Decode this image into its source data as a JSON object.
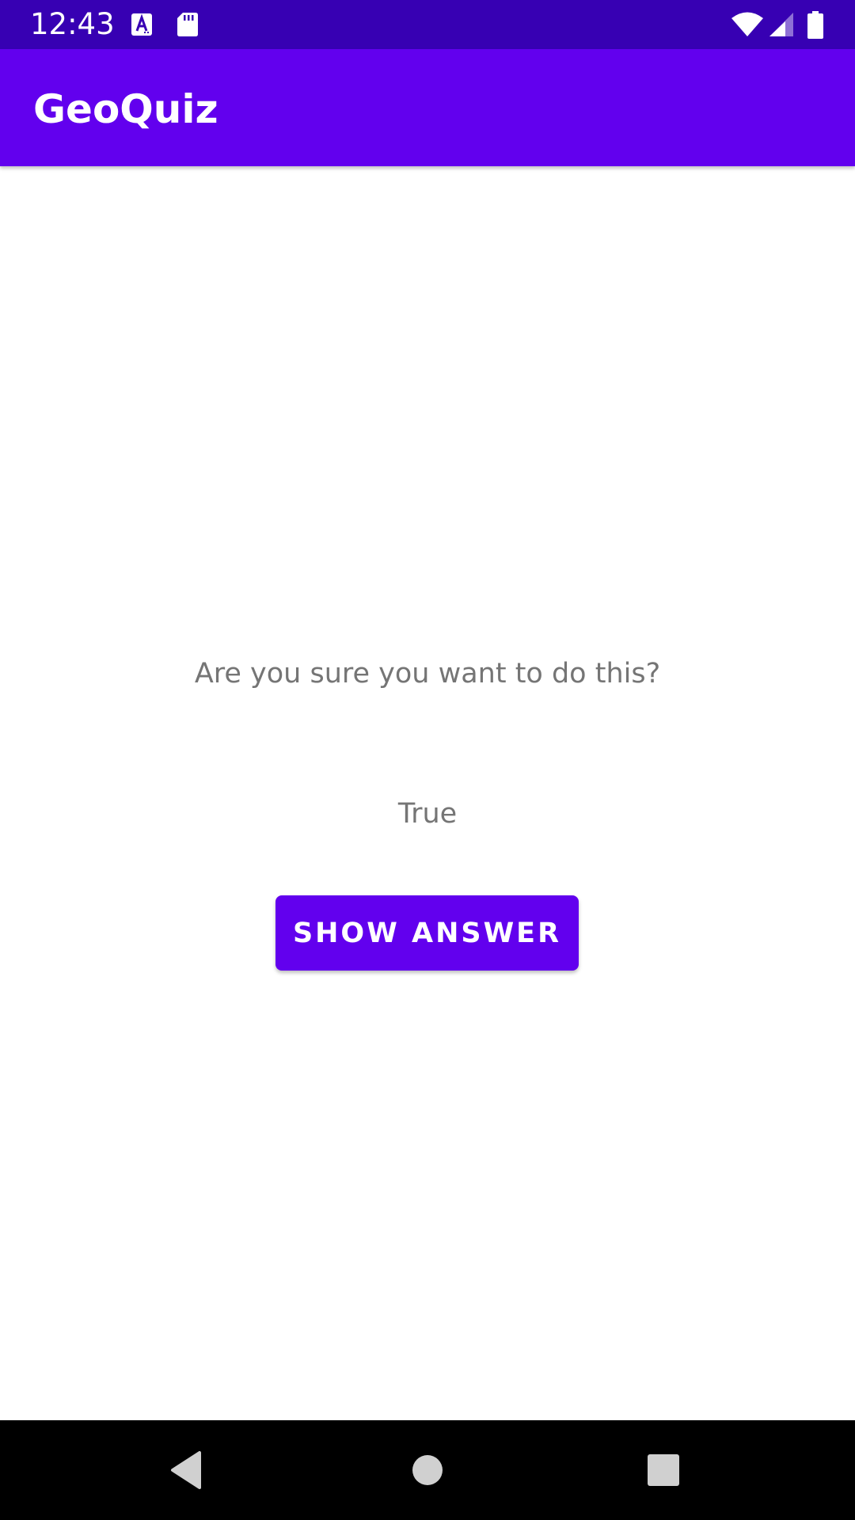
{
  "status_bar": {
    "time": "12:43",
    "icons": [
      "text-a-icon",
      "sd-card-icon",
      "wifi-icon",
      "signal-icon",
      "battery-icon"
    ],
    "background_color": "#3700b3"
  },
  "app_bar": {
    "title": "GeoQuiz",
    "background_color": "#6200ee"
  },
  "content": {
    "warning_text": "Are you sure you want to do this?",
    "answer_text": "True",
    "show_answer_button_label": "SHOW ANSWER",
    "accent_color": "#6200ee",
    "text_color": "#757575"
  },
  "nav_bar": {
    "icons": [
      "back-icon",
      "home-icon",
      "recents-icon"
    ]
  }
}
